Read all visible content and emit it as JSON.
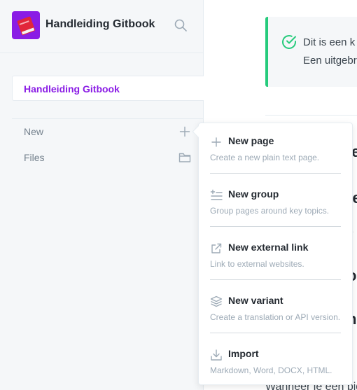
{
  "sidebar": {
    "site_title": "Handleiding Gitbook",
    "space_item": "Handleiding Gitbook",
    "rows": [
      {
        "label": "New",
        "icon": "plus-icon"
      },
      {
        "label": "Files",
        "icon": "folder-icon"
      }
    ]
  },
  "main": {
    "hint_line1": "Dit is een k",
    "hint_line2": "Een uitgebr",
    "fragments": [
      "ie",
      "te",
      "e",
      "ol",
      "ni",
      "Wanneer je een pig"
    ]
  },
  "menu": {
    "items": [
      {
        "title": "New page",
        "description": "Create a new plain text page.",
        "icon": "plus-icon"
      },
      {
        "title": "New group",
        "description": "Group pages around key topics.",
        "icon": "group-list-icon"
      },
      {
        "title": "New external link",
        "description": "Link to external websites.",
        "icon": "external-link-icon"
      },
      {
        "title": "New variant",
        "description": "Create a translation or API version.",
        "icon": "layers-icon"
      },
      {
        "title": "Import",
        "description": "Markdown, Word, DOCX, HTML.",
        "icon": "download-icon"
      }
    ]
  },
  "colors": {
    "accent": "#8a1ce5",
    "hint_success": "#26cb7c",
    "sidebar_bg": "#f5f7f9"
  }
}
